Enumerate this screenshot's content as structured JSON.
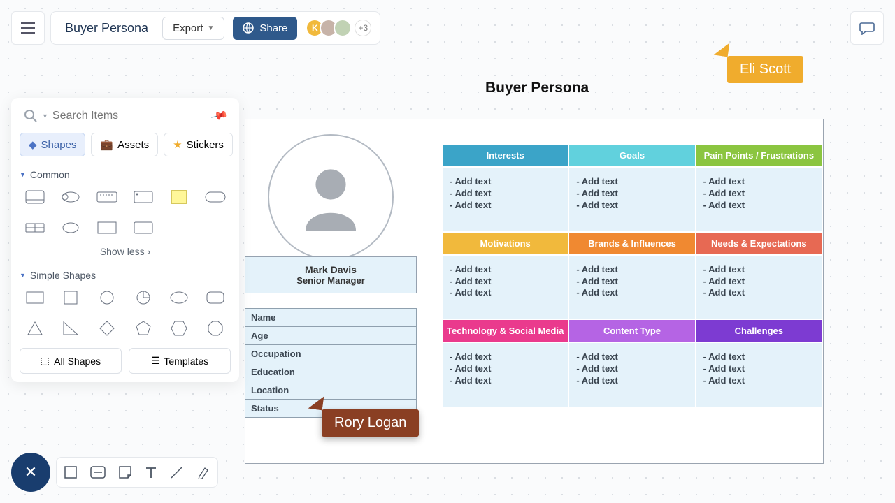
{
  "header": {
    "title": "Buyer Persona",
    "export": "Export",
    "share": "Share",
    "avatar_initial": "K",
    "plus_count": "+3"
  },
  "search": {
    "placeholder": "Search Items"
  },
  "tabs": {
    "shapes": "Shapes",
    "assets": "Assets",
    "stickers": "Stickers"
  },
  "sections": {
    "common": "Common",
    "simple": "Simple Shapes",
    "show_less": "Show less",
    "all_shapes": "All Shapes",
    "templates": "Templates"
  },
  "canvas": {
    "title": "Buyer Persona",
    "persona_name": "Mark Davis",
    "persona_role": "Senior Manager"
  },
  "fields": [
    "Name",
    "Age",
    "Occupation",
    "Education",
    "Location",
    "Status"
  ],
  "grid": {
    "headers": [
      [
        "Interests",
        "Goals",
        "Pain Points / Frustrations"
      ],
      [
        "Motivations",
        "Brands & Influences",
        "Needs & Expectations"
      ],
      [
        "Technology & Social Media",
        "Content Type",
        "Challenges"
      ]
    ],
    "colors": [
      [
        "#3ba4c8",
        "#61d1dd",
        "#8bc540"
      ],
      [
        "#f1b93c",
        "#f08931",
        "#e76953"
      ],
      [
        "#ea3a8d",
        "#b564e4",
        "#7d3bd2"
      ]
    ],
    "placeholder": "- Add text"
  },
  "cursors": {
    "eli": "Eli Scott",
    "rory": "Rory Logan"
  }
}
